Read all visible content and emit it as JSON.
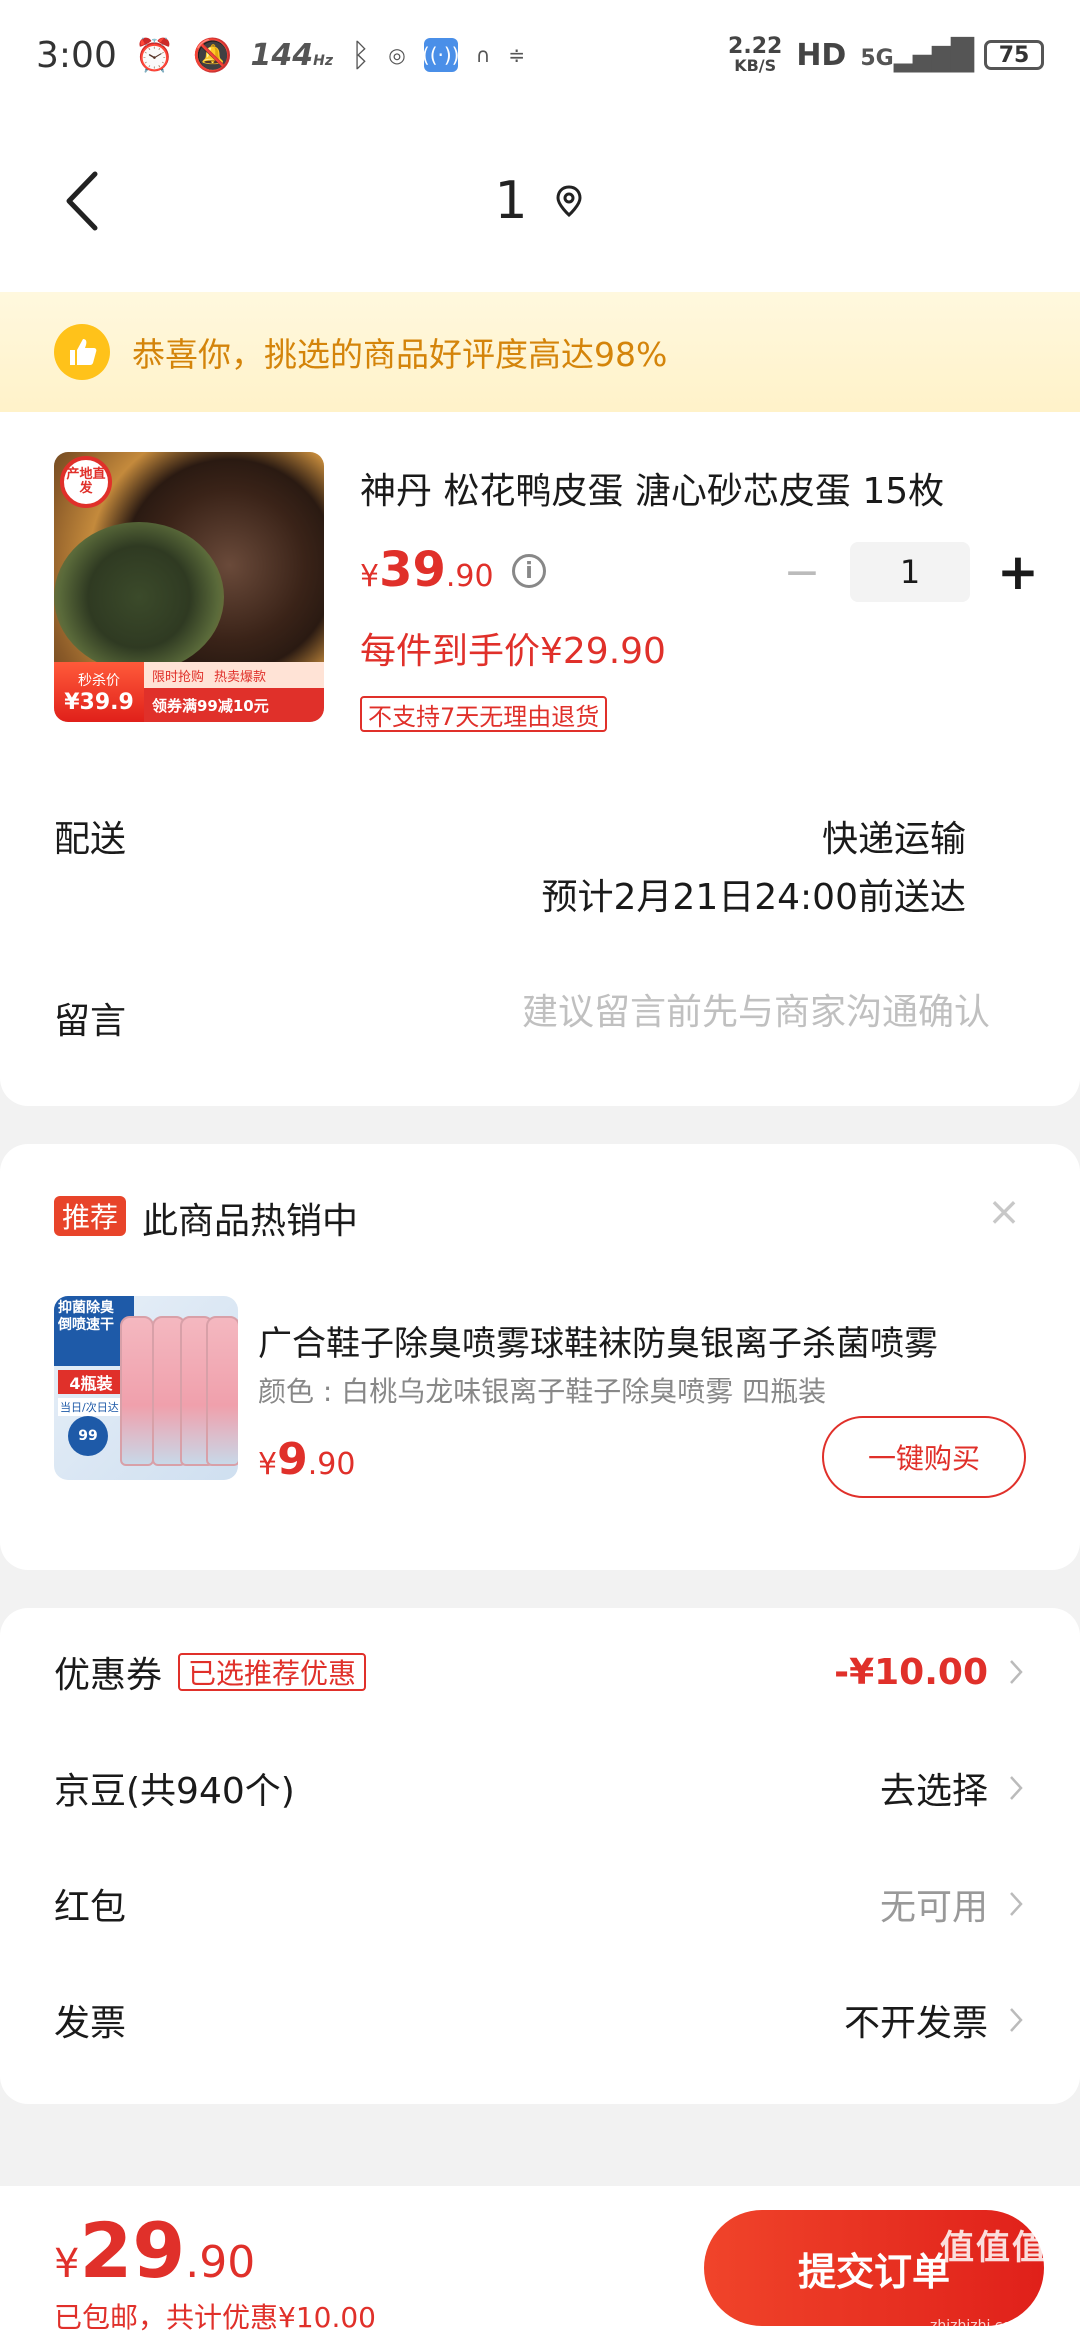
{
  "status_bar": {
    "time": "3:00",
    "refresh_rate": "144",
    "refresh_unit": "Hz",
    "net_speed": "2.22",
    "net_unit": "KB/S",
    "hd": "HD",
    "network": "5G",
    "battery": "75"
  },
  "nav": {
    "title": "1"
  },
  "banner": {
    "text": "恭喜你，挑选的商品好评度高达98%"
  },
  "product": {
    "title": "神丹 松花鸭皮蛋 溏心砂芯皮蛋 15枚",
    "price_symbol": "¥",
    "price_int": "39",
    "price_dec": ".90",
    "unit_price": "每件到手价¥29.90",
    "quantity": "1",
    "minus_label": "−",
    "plus_label": "+",
    "info_label": "i",
    "return_tag": "不支持7天无理由退货",
    "image": {
      "origin_badge": "产地直发",
      "flash_label": "秒杀价",
      "flash_price": "¥39.9",
      "promo_1": "限时抢购",
      "promo_2": "热卖爆款",
      "coupon": "领券满99减10元"
    }
  },
  "delivery": {
    "label": "配送",
    "method": "快递运输",
    "eta": "预计2月21日24:00前送达"
  },
  "note": {
    "label": "留言",
    "placeholder": "建议留言前先与商家沟通确认"
  },
  "recommend": {
    "tag": "推荐",
    "title": "此商品热销中",
    "close": "×",
    "name": "广合鞋子除臭喷雾球鞋袜防臭银离子杀菌喷雾",
    "spec": "颜色 : 白桃乌龙味银离子鞋子除臭喷雾 四瓶装",
    "price_symbol": "¥",
    "price_int": "9",
    "price_dec": ".90",
    "buy_label": "一键购买",
    "image": {
      "headline": "抑菌除臭 倒喷速干",
      "pack": "4瓶装",
      "delivery": "当日/次日达",
      "price": "99"
    }
  },
  "benefits": {
    "coupon_label": "优惠券",
    "coupon_tag": "已选推荐优惠",
    "coupon_value": "-¥10.00",
    "beans_label": "京豆(共940个)",
    "beans_value": "去选择",
    "redpack_label": "红包",
    "redpack_value": "无可用",
    "invoice_label": "发票",
    "invoice_value": "不开发票"
  },
  "bottom": {
    "price_symbol": "¥",
    "price_int": "29",
    "price_dec": ".90",
    "note": "已包邮，共计优惠¥10.00",
    "submit_label": "提交订单"
  },
  "watermark": {
    "text": "值值值",
    "sub": "zhizhizhi.com"
  },
  "colors": {
    "accent": "#e0302a",
    "banner_bg": "#fff8de",
    "banner_text": "#d4840a",
    "page_bg": "#f2f2f2"
  }
}
